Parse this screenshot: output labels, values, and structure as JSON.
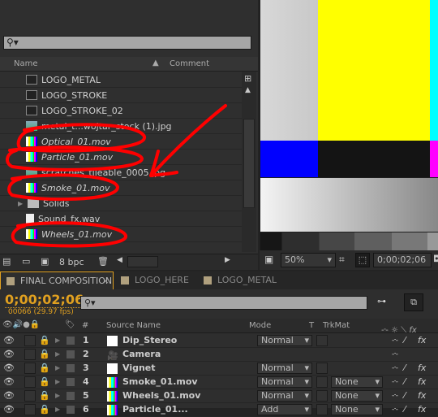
{
  "project": {
    "search_placeholder": "",
    "columns": {
      "name": "Name",
      "comment": "Comment"
    },
    "items": [
      {
        "label": "LOGO_METAL",
        "icon": "composition-icon",
        "italic": false
      },
      {
        "label": "LOGO_STROKE",
        "icon": "composition-icon",
        "italic": false
      },
      {
        "label": "LOGO_STROKE_02",
        "icon": "composition-icon",
        "italic": false
      },
      {
        "label": "metal_t...wojtar_stock (1).jpg",
        "icon": "image-icon",
        "italic": false
      },
      {
        "label": "Optical_01.mov",
        "icon": "color-bars-icon",
        "italic": true
      },
      {
        "label": "Particle_01.mov",
        "icon": "color-bars-icon",
        "italic": true
      },
      {
        "label": "scratches_tileable_0005.jpg",
        "icon": "image-icon",
        "italic": false
      },
      {
        "label": "Smoke_01.mov",
        "icon": "color-bars-icon",
        "italic": true
      },
      {
        "label": "Solids",
        "icon": "folder-icon",
        "italic": false
      },
      {
        "label": "Sound_fx.wav",
        "icon": "audio-file-icon",
        "italic": false
      },
      {
        "label": "Wheels_01.mov",
        "icon": "color-bars-icon",
        "italic": true
      }
    ],
    "bpc": "8 bpc"
  },
  "viewer": {
    "zoom": "50%",
    "timecode": "0;00;02;06"
  },
  "timeline": {
    "tabs": [
      {
        "label": "FINAL COMPOSITION",
        "active": true
      },
      {
        "label": "LOGO_HERE"
      },
      {
        "label": "LOGO_METAL"
      }
    ],
    "timecode": "0;00;02;06",
    "frame_info": "00066 (29.97 fps)",
    "columns": {
      "num": "#",
      "source": "Source Name",
      "mode": "Mode",
      "t": "T",
      "trkmat": "TrkMat"
    },
    "layers": [
      {
        "num": "1",
        "name": "Dip_Stereo",
        "icon": "solid-icon",
        "mode": "Normal",
        "trkmat": ""
      },
      {
        "num": "2",
        "name": "Camera",
        "icon": "camera-icon",
        "mode": "",
        "trkmat": ""
      },
      {
        "num": "3",
        "name": "Vignet",
        "icon": "solid-icon",
        "mode": "Normal",
        "trkmat": ""
      },
      {
        "num": "4",
        "name": "Smoke_01.mov",
        "icon": "color-bars-icon",
        "mode": "Normal",
        "trkmat": "None"
      },
      {
        "num": "5",
        "name": "Wheels_01.mov",
        "icon": "color-bars-icon",
        "mode": "Normal",
        "trkmat": "None"
      },
      {
        "num": "6",
        "name": "Particle_01...",
        "icon": "color-bars-icon",
        "mode": "Add",
        "trkmat": "None"
      }
    ]
  },
  "colors": {
    "timecode": "#e0a020",
    "annotation": "#ff0000",
    "active_tab_border": "#e0a020"
  }
}
